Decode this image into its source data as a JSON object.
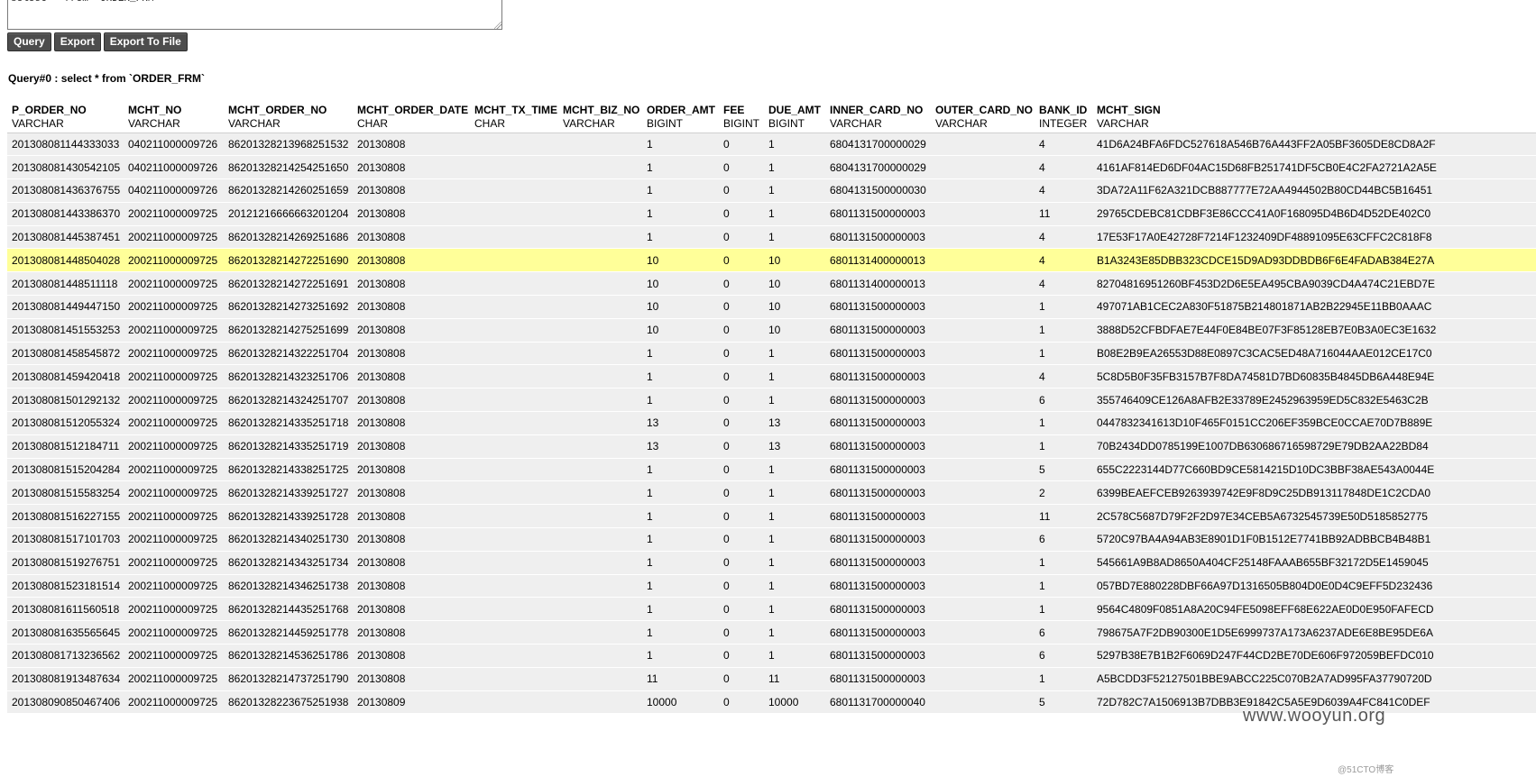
{
  "editor": {
    "sql_text": "select * from `ORDER_FRM`"
  },
  "toolbar": {
    "query_label": "Query",
    "export_label": "Export",
    "export_file_label": "Export To File"
  },
  "result": {
    "label": "Query#0 : select * from `ORDER_FRM`",
    "columns": [
      {
        "name": "P_ORDER_NO",
        "type": "VARCHAR"
      },
      {
        "name": "MCHT_NO",
        "type": "VARCHAR"
      },
      {
        "name": "MCHT_ORDER_NO",
        "type": "VARCHAR"
      },
      {
        "name": "MCHT_ORDER_DATE",
        "type": "CHAR"
      },
      {
        "name": "MCHT_TX_TIME",
        "type": "CHAR"
      },
      {
        "name": "MCHT_BIZ_NO",
        "type": "VARCHAR"
      },
      {
        "name": "ORDER_AMT",
        "type": "BIGINT"
      },
      {
        "name": "FEE",
        "type": "BIGINT"
      },
      {
        "name": "DUE_AMT",
        "type": "BIGINT"
      },
      {
        "name": "INNER_CARD_NO",
        "type": "VARCHAR"
      },
      {
        "name": "OUTER_CARD_NO",
        "type": "VARCHAR"
      },
      {
        "name": "BANK_ID",
        "type": "INTEGER"
      },
      {
        "name": "MCHT_SIGN",
        "type": "VARCHAR"
      }
    ],
    "highlight_row": 5,
    "rows": [
      [
        "201308081144333033",
        "040211000009726",
        "86201328213968251532",
        "20130808",
        "",
        "",
        "1",
        "0",
        "1",
        "6804131700000029",
        "",
        "4",
        "41D6A24BFA6FDC527618A546B76A443FF2A05BF3605DE8CD8A2F"
      ],
      [
        "201308081430542105",
        "040211000009726",
        "86201328214254251650",
        "20130808",
        "",
        "",
        "1",
        "0",
        "1",
        "6804131700000029",
        "",
        "4",
        "4161AF814ED6DF04AC15D68FB251741DF5CB0E4C2FA2721A2A5E"
      ],
      [
        "201308081436376755",
        "040211000009726",
        "86201328214260251659",
        "20130808",
        "",
        "",
        "1",
        "0",
        "1",
        "6804131500000030",
        "",
        "4",
        "3DA72A11F62A321DCB887777E72AA4944502B80CD44BC5B16451"
      ],
      [
        "201308081443386370",
        "200211000009725",
        "20121216666663201204",
        "20130808",
        "",
        "",
        "1",
        "0",
        "1",
        "6801131500000003",
        "",
        "11",
        "29765CDEBC81CDBF3E86CCC41A0F168095D4B6D4D52DE402C0"
      ],
      [
        "201308081445387451",
        "200211000009725",
        "86201328214269251686",
        "20130808",
        "",
        "",
        "1",
        "0",
        "1",
        "6801131500000003",
        "",
        "4",
        "17E53F17A0E42728F7214F1232409DF48891095E63CFFC2C818F8"
      ],
      [
        "201308081448504028",
        "200211000009725",
        "86201328214272251690",
        "20130808",
        "",
        "",
        "10",
        "0",
        "10",
        "6801131400000013",
        "",
        "4",
        "B1A3243E85DBB323CDCE15D9AD93DDBDB6F6E4FADAB384E27A"
      ],
      [
        "201308081448511118",
        "200211000009725",
        "86201328214272251691",
        "20130808",
        "",
        "",
        "10",
        "0",
        "10",
        "6801131400000013",
        "",
        "4",
        "82704816951260BF453D2D6E5EA495CBA9039CD4A474C21EBD7E"
      ],
      [
        "201308081449447150",
        "200211000009725",
        "86201328214273251692",
        "20130808",
        "",
        "",
        "10",
        "0",
        "10",
        "6801131500000003",
        "",
        "1",
        "497071AB1CEC2A830F51875B214801871AB2B22945E11BB0AAAC"
      ],
      [
        "201308081451553253",
        "200211000009725",
        "86201328214275251699",
        "20130808",
        "",
        "",
        "10",
        "0",
        "10",
        "6801131500000003",
        "",
        "1",
        "3888D52CFBDFAE7E44F0E84BE07F3F85128EB7E0B3A0EC3E1632"
      ],
      [
        "201308081458545872",
        "200211000009725",
        "86201328214322251704",
        "20130808",
        "",
        "",
        "1",
        "0",
        "1",
        "6801131500000003",
        "",
        "1",
        "B08E2B9EA26553D88E0897C3CAC5ED48A716044AAE012CE17C0"
      ],
      [
        "201308081459420418",
        "200211000009725",
        "86201328214323251706",
        "20130808",
        "",
        "",
        "1",
        "0",
        "1",
        "6801131500000003",
        "",
        "4",
        "5C8D5B0F35FB3157B7F8DA74581D7BD60835B4845DB6A448E94E"
      ],
      [
        "201308081501292132",
        "200211000009725",
        "86201328214324251707",
        "20130808",
        "",
        "",
        "1",
        "0",
        "1",
        "6801131500000003",
        "",
        "6",
        "355746409CE126A8AFB2E33789E2452963959ED5C832E5463C2B"
      ],
      [
        "201308081512055324",
        "200211000009725",
        "86201328214335251718",
        "20130808",
        "",
        "",
        "13",
        "0",
        "13",
        "6801131500000003",
        "",
        "1",
        "0447832341613D10F465F0151CC206EF359BCE0CCAE70D7B889E"
      ],
      [
        "201308081512184711",
        "200211000009725",
        "86201328214335251719",
        "20130808",
        "",
        "",
        "13",
        "0",
        "13",
        "6801131500000003",
        "",
        "1",
        "70B2434DD0785199E1007DB630686716598729E79DB2AA22BD84"
      ],
      [
        "201308081515204284",
        "200211000009725",
        "86201328214338251725",
        "20130808",
        "",
        "",
        "1",
        "0",
        "1",
        "6801131500000003",
        "",
        "5",
        "655C2223144D77C660BD9CE5814215D10DC3BBF38AE543A0044E"
      ],
      [
        "201308081515583254",
        "200211000009725",
        "86201328214339251727",
        "20130808",
        "",
        "",
        "1",
        "0",
        "1",
        "6801131500000003",
        "",
        "2",
        "6399BEAEFCEB9263939742E9F8D9C25DB913117848DE1C2CDA0"
      ],
      [
        "201308081516227155",
        "200211000009725",
        "86201328214339251728",
        "20130808",
        "",
        "",
        "1",
        "0",
        "1",
        "6801131500000003",
        "",
        "11",
        "2C578C5687D79F2F2D97E34CEB5A6732545739E50D5185852775"
      ],
      [
        "201308081517101703",
        "200211000009725",
        "86201328214340251730",
        "20130808",
        "",
        "",
        "1",
        "0",
        "1",
        "6801131500000003",
        "",
        "6",
        "5720C97BA4A94AB3E8901D1F0B1512E7741BB92ADBBCB4B48B1"
      ],
      [
        "201308081519276751",
        "200211000009725",
        "86201328214343251734",
        "20130808",
        "",
        "",
        "1",
        "0",
        "1",
        "6801131500000003",
        "",
        "1",
        "545661A9B8AD8650A404CF25148FAAAB655BF32172D5E1459045"
      ],
      [
        "201308081523181514",
        "200211000009725",
        "86201328214346251738",
        "20130808",
        "",
        "",
        "1",
        "0",
        "1",
        "6801131500000003",
        "",
        "1",
        "057BD7E880228DBF66A97D1316505B804D0E0D4C9EFF5D232436"
      ],
      [
        "201308081611560518",
        "200211000009725",
        "86201328214435251768",
        "20130808",
        "",
        "",
        "1",
        "0",
        "1",
        "6801131500000003",
        "",
        "1",
        "9564C4809F0851A8A20C94FE5098EFF68E622AE0D0E950FAFECD"
      ],
      [
        "201308081635565645",
        "200211000009725",
        "86201328214459251778",
        "20130808",
        "",
        "",
        "1",
        "0",
        "1",
        "6801131500000003",
        "",
        "6",
        "798675A7F2DB90300E1D5E6999737A173A6237ADE6E8BE95DE6A"
      ],
      [
        "201308081713236562",
        "200211000009725",
        "86201328214536251786",
        "20130808",
        "",
        "",
        "1",
        "0",
        "1",
        "6801131500000003",
        "",
        "6",
        "5297B38E7B1B2F6069D247F44CD2BE70DE606F972059BEFDC010"
      ],
      [
        "201308081913487634",
        "200211000009725",
        "86201328214737251790",
        "20130808",
        "",
        "",
        "11",
        "0",
        "11",
        "6801131500000003",
        "",
        "1",
        "A5BCDD3F52127501BBE9ABCC225C070B2A7AD995FA37790720D"
      ],
      [
        "201308090850467406",
        "200211000009725",
        "86201328223675251938",
        "20130809",
        "",
        "",
        "10000",
        "0",
        "10000",
        "6801131700000040",
        "",
        "5",
        "72D782C7A1506913B7DBB3E91842C5A5E9D6039A4FC841C0DEF"
      ]
    ]
  },
  "watermark": {
    "text": "www.wooyun.org",
    "sub_text": "@51CTO博客"
  }
}
